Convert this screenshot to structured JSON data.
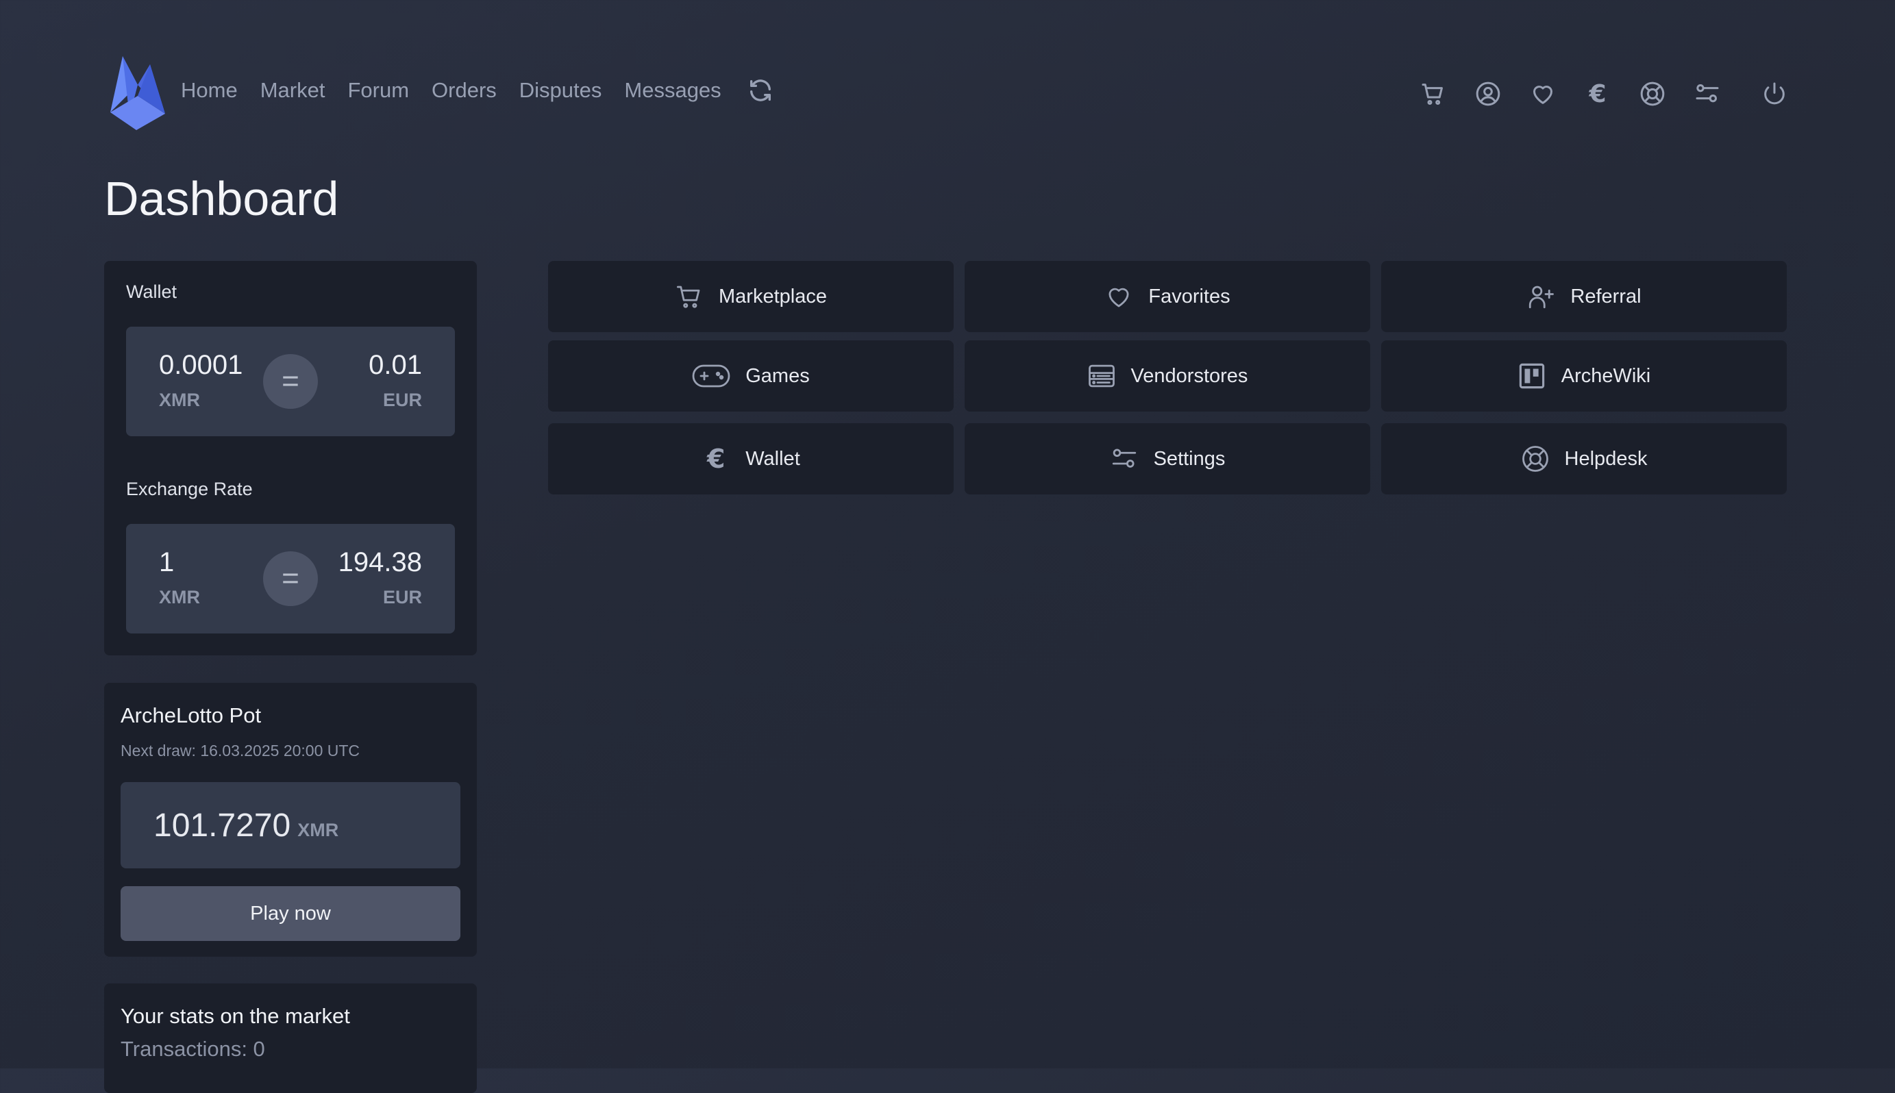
{
  "nav": {
    "links": [
      "Home",
      "Market",
      "Forum",
      "Orders",
      "Disputes",
      "Messages"
    ],
    "icons": {
      "cart": "cart-icon",
      "account": "user-circle-icon",
      "favorites": "heart-icon",
      "currency": "€",
      "help": "lifebuoy-icon",
      "settings": "sliders-icon",
      "logout": "power-icon"
    }
  },
  "page": {
    "title": "Dashboard"
  },
  "wallet": {
    "label": "Wallet",
    "balance_xmr": "0.0001",
    "balance_xmr_unit": "XMR",
    "balance_eur": "0.01",
    "balance_eur_unit": "EUR",
    "exchange_label": "Exchange Rate",
    "rate_xmr": "1",
    "rate_xmr_unit": "XMR",
    "rate_eur": "194.38",
    "rate_eur_unit": "EUR",
    "equals_symbol": "="
  },
  "lotto": {
    "title": "ArcheLotto Pot",
    "next_draw": "Next draw: 16.03.2025 20:00 UTC",
    "pot_value": "101.7270",
    "pot_unit": "XMR",
    "play_label": "Play now"
  },
  "stats": {
    "title": "Your stats on the market",
    "transactions": "Transactions: 0"
  },
  "tiles": {
    "marketplace": "Marketplace",
    "favorites": "Favorites",
    "referral": "Referral",
    "games": "Games",
    "vendorstores": "Vendorstores",
    "archewiki": "ArcheWiki",
    "wallet": "Wallet",
    "wallet_symbol": "€",
    "settings": "Settings",
    "helpdesk": "Helpdesk"
  },
  "colors": {
    "background": "#262b39",
    "card": "#1b1f2a",
    "inner_box": "#333a4b",
    "button": "#4f5568",
    "logo": "#5b79ee",
    "muted_text": "#98a0b3"
  }
}
